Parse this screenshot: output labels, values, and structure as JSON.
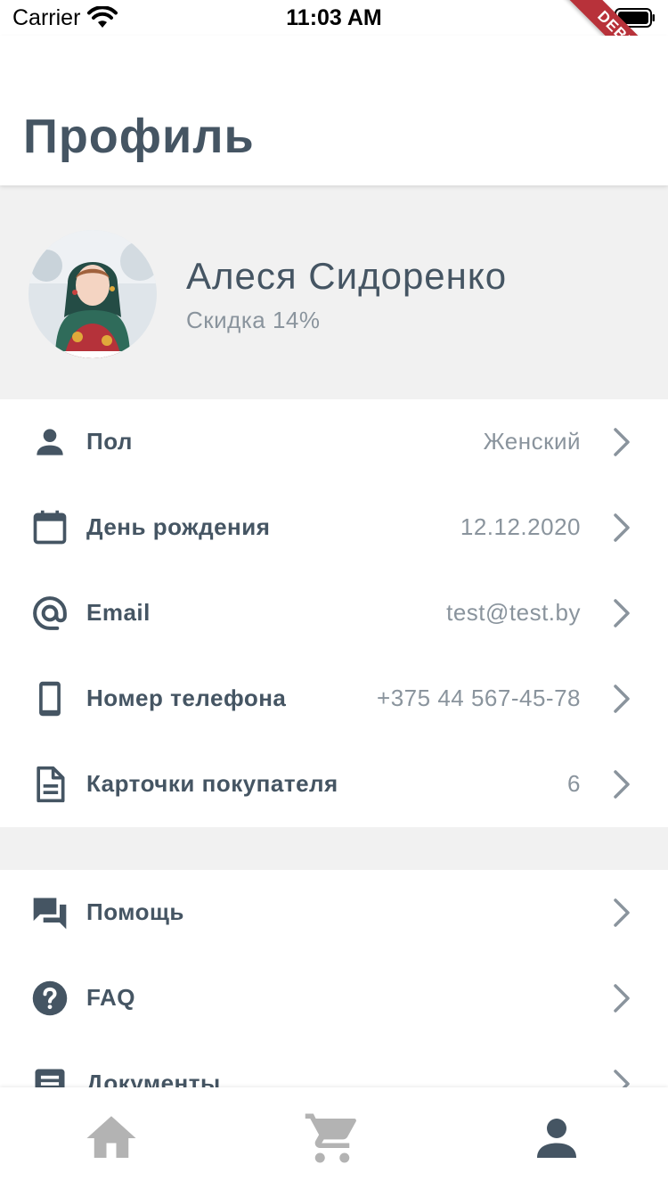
{
  "status_bar": {
    "carrier": "Carrier",
    "time": "11:03 AM",
    "debug_banner": "DEBUG"
  },
  "header": {
    "title": "Профиль"
  },
  "profile": {
    "name": "Алеся Сидоренко",
    "discount": "Скидка 14%",
    "avatar_icon": "user-photo"
  },
  "info_rows": [
    {
      "icon": "person-icon",
      "label": "Пол",
      "value": "Женский"
    },
    {
      "icon": "calendar-icon",
      "label": "День рождения",
      "value": "12.12.2020"
    },
    {
      "icon": "at-sign-icon",
      "label": "Email",
      "value": "test@test.by"
    },
    {
      "icon": "phone-icon",
      "label": "Номер телефона",
      "value": "+375 44 567-45-78"
    },
    {
      "icon": "document-icon",
      "label": "Карточки покупателя",
      "value": "6"
    }
  ],
  "support_rows": [
    {
      "icon": "chat-icon",
      "label": "Помощь"
    },
    {
      "icon": "question-icon",
      "label": "FAQ"
    },
    {
      "icon": "documents-icon",
      "label": "Документы"
    }
  ],
  "bottom_nav": {
    "items": [
      {
        "icon": "home-icon",
        "active": false
      },
      {
        "icon": "cart-icon",
        "active": false
      },
      {
        "icon": "profile-icon",
        "active": true
      }
    ]
  },
  "colors": {
    "primary_text": "#455563",
    "secondary_text": "#8a949d",
    "section_bg": "#f1f1f1",
    "inactive_nav": "#b3b3b3",
    "debug_ribbon": "#b8323a"
  }
}
